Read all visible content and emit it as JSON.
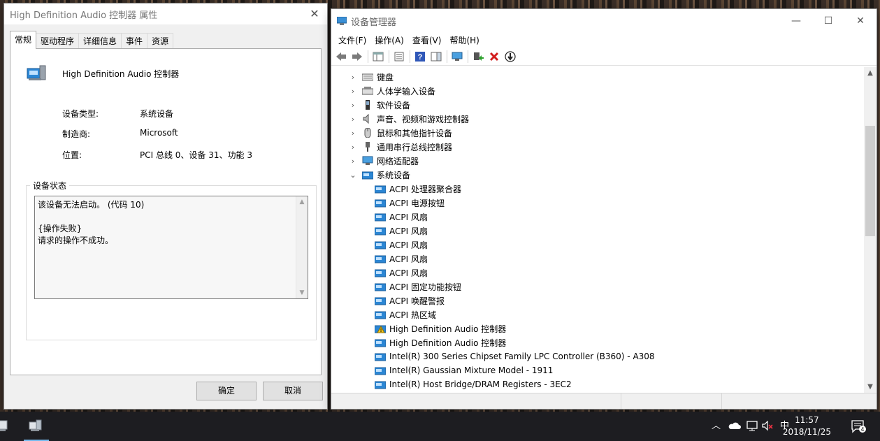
{
  "dialog": {
    "title": "High Definition Audio 控制器 属性",
    "close_glyph": "✕",
    "tabs": [
      "常规",
      "驱动程序",
      "详细信息",
      "事件",
      "资源"
    ],
    "device_name": "High Definition Audio 控制器",
    "props": [
      {
        "label": "设备类型:",
        "value": "系统设备"
      },
      {
        "label": "制造商:",
        "value": "Microsoft"
      },
      {
        "label": "位置:",
        "value": "PCI 总线 0、设备 31、功能 3"
      }
    ],
    "status_group_label": "设备状态",
    "status_text": "该设备无法启动。 (代码 10)\n\n{操作失败}\n请求的操作不成功。",
    "ok_label": "确定",
    "cancel_label": "取消"
  },
  "manager": {
    "title": "设备管理器",
    "menu": [
      "文件(F)",
      "操作(A)",
      "查看(V)",
      "帮助(H)"
    ],
    "window_controls": {
      "minimize": "—",
      "maximize": "☐",
      "close": "✕"
    },
    "categories": [
      {
        "label": "键盘",
        "expanded": false,
        "icon": "keyboard-icon"
      },
      {
        "label": "人体学输入设备",
        "expanded": false,
        "icon": "hid-icon"
      },
      {
        "label": "软件设备",
        "expanded": false,
        "icon": "software-device-icon"
      },
      {
        "label": "声音、视频和游戏控制器",
        "expanded": false,
        "icon": "speaker-icon"
      },
      {
        "label": "鼠标和其他指针设备",
        "expanded": false,
        "icon": "mouse-icon"
      },
      {
        "label": "通用串行总线控制器",
        "expanded": false,
        "icon": "usb-icon"
      },
      {
        "label": "网络适配器",
        "expanded": false,
        "icon": "network-adapter-icon"
      },
      {
        "label": "系统设备",
        "expanded": true,
        "icon": "system-device-icon"
      }
    ],
    "system_devices": [
      {
        "label": "ACPI 处理器聚合器",
        "warning": false
      },
      {
        "label": "ACPI 电源按钮",
        "warning": false
      },
      {
        "label": "ACPI 风扇",
        "warning": false
      },
      {
        "label": "ACPI 风扇",
        "warning": false
      },
      {
        "label": "ACPI 风扇",
        "warning": false
      },
      {
        "label": "ACPI 风扇",
        "warning": false
      },
      {
        "label": "ACPI 风扇",
        "warning": false
      },
      {
        "label": "ACPI 固定功能按钮",
        "warning": false
      },
      {
        "label": "ACPI 唤醒警报",
        "warning": false
      },
      {
        "label": "ACPI 热区域",
        "warning": false
      },
      {
        "label": "High Definition Audio 控制器",
        "warning": true
      },
      {
        "label": "High Definition Audio 控制器",
        "warning": false
      },
      {
        "label": "Intel(R) 300 Series Chipset Family LPC Controller (B360) - A308",
        "warning": false
      },
      {
        "label": "Intel(R) Gaussian Mixture Model - 1911",
        "warning": false
      },
      {
        "label": "Intel(R) Host Bridge/DRAM Registers - 3EC2",
        "warning": false
      }
    ]
  },
  "taskbar": {
    "ime": "中",
    "time": "11:57",
    "date": "2018/11/25",
    "notification_count": "4"
  }
}
